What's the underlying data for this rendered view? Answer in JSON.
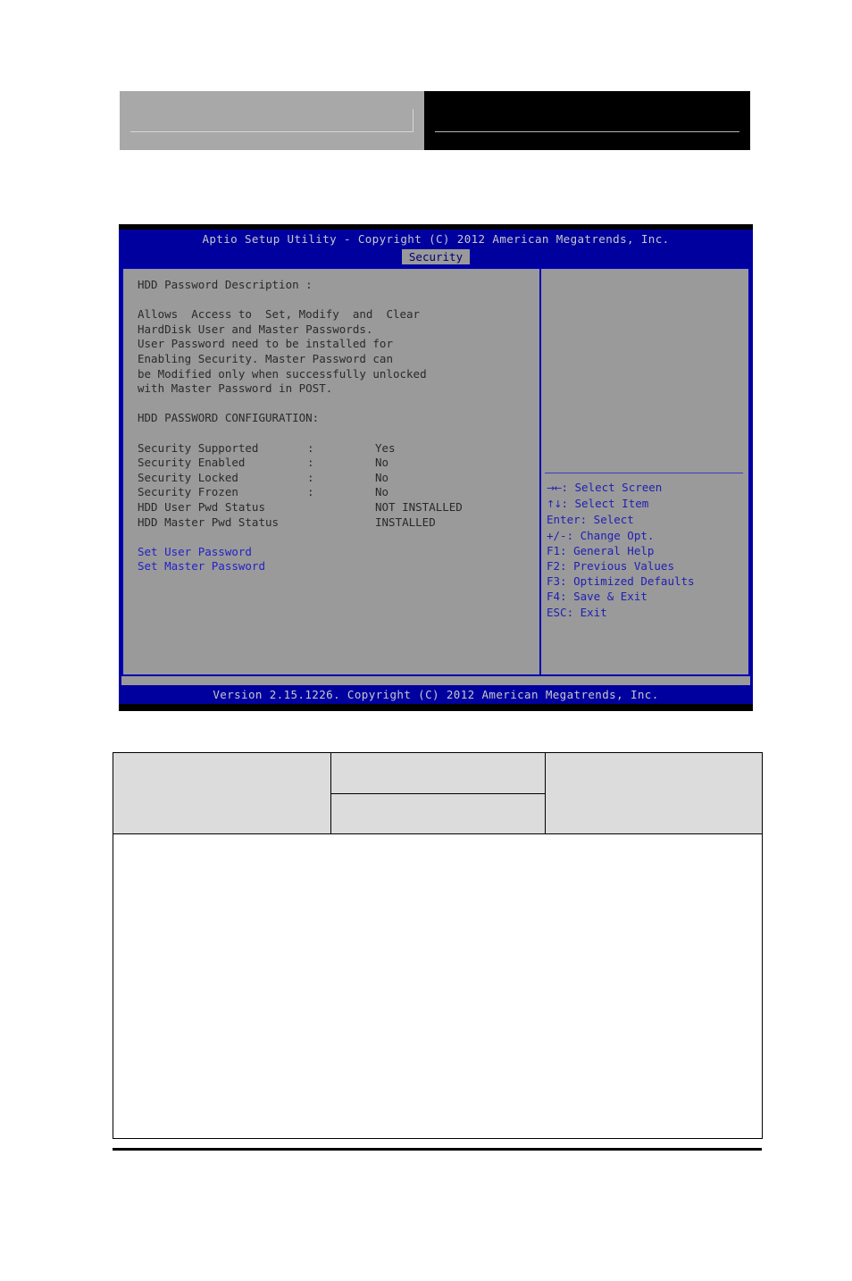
{
  "header": {
    "left_box_label": "",
    "right_box_label": ""
  },
  "bios": {
    "title": "Aptio Setup Utility - Copyright (C) 2012 American Megatrends, Inc.",
    "active_tab": "Security",
    "version": "Version 2.15.1226. Copyright (C) 2012 American Megatrends, Inc.",
    "colors": {
      "screen_blue": "#00009f",
      "panel_gray": "#9a9a9a",
      "border_blue": "#0000b4",
      "link_blue": "#2222c8",
      "help_blue": "#1e1eb4",
      "title_text": "#c8c8c8",
      "body_text": "#2a2a2a"
    },
    "description": {
      "heading": "HDD Password Description :",
      "lines": [
        "Allows  Access to  Set, Modify  and  Clear",
        "HardDisk User and Master Passwords.",
        "User Password need to be installed for",
        "Enabling Security. Master Password can",
        "be Modified only when successfully unlocked",
        "with Master Password in POST."
      ]
    },
    "config": {
      "heading": "HDD PASSWORD CONFIGURATION:",
      "rows": [
        {
          "label": "Security Supported",
          "colon": ":",
          "value": "Yes"
        },
        {
          "label": "Security Enabled",
          "colon": ":",
          "value": "No"
        },
        {
          "label": "Security Locked",
          "colon": ":",
          "value": "No"
        },
        {
          "label": "Security Frozen",
          "colon": ":",
          "value": "No"
        },
        {
          "label": "HDD User Pwd Status",
          "colon": "",
          "value": "NOT INSTALLED"
        },
        {
          "label": "HDD Master Pwd Status",
          "colon": "",
          "value": "INSTALLED"
        }
      ]
    },
    "actions": [
      {
        "label": "Set User Password"
      },
      {
        "label": "Set Master Password"
      }
    ],
    "help": [
      {
        "glyph": "→←",
        "text": ": Select Screen"
      },
      {
        "glyph": "↑↓",
        "text": ": Select Item"
      },
      {
        "glyph": "",
        "text": "Enter: Select"
      },
      {
        "glyph": "",
        "text": "+/-: Change Opt."
      },
      {
        "glyph": "",
        "text": "F1: General Help"
      },
      {
        "glyph": "",
        "text": "F2: Previous Values"
      },
      {
        "glyph": "",
        "text": "F3: Optimized Defaults"
      },
      {
        "glyph": "",
        "text": "F4: Save & Exit"
      },
      {
        "glyph": "",
        "text": "ESC: Exit"
      }
    ]
  },
  "bottom_table": {
    "header_cells": [
      "",
      "",
      "",
      ""
    ],
    "body_cell": ""
  }
}
